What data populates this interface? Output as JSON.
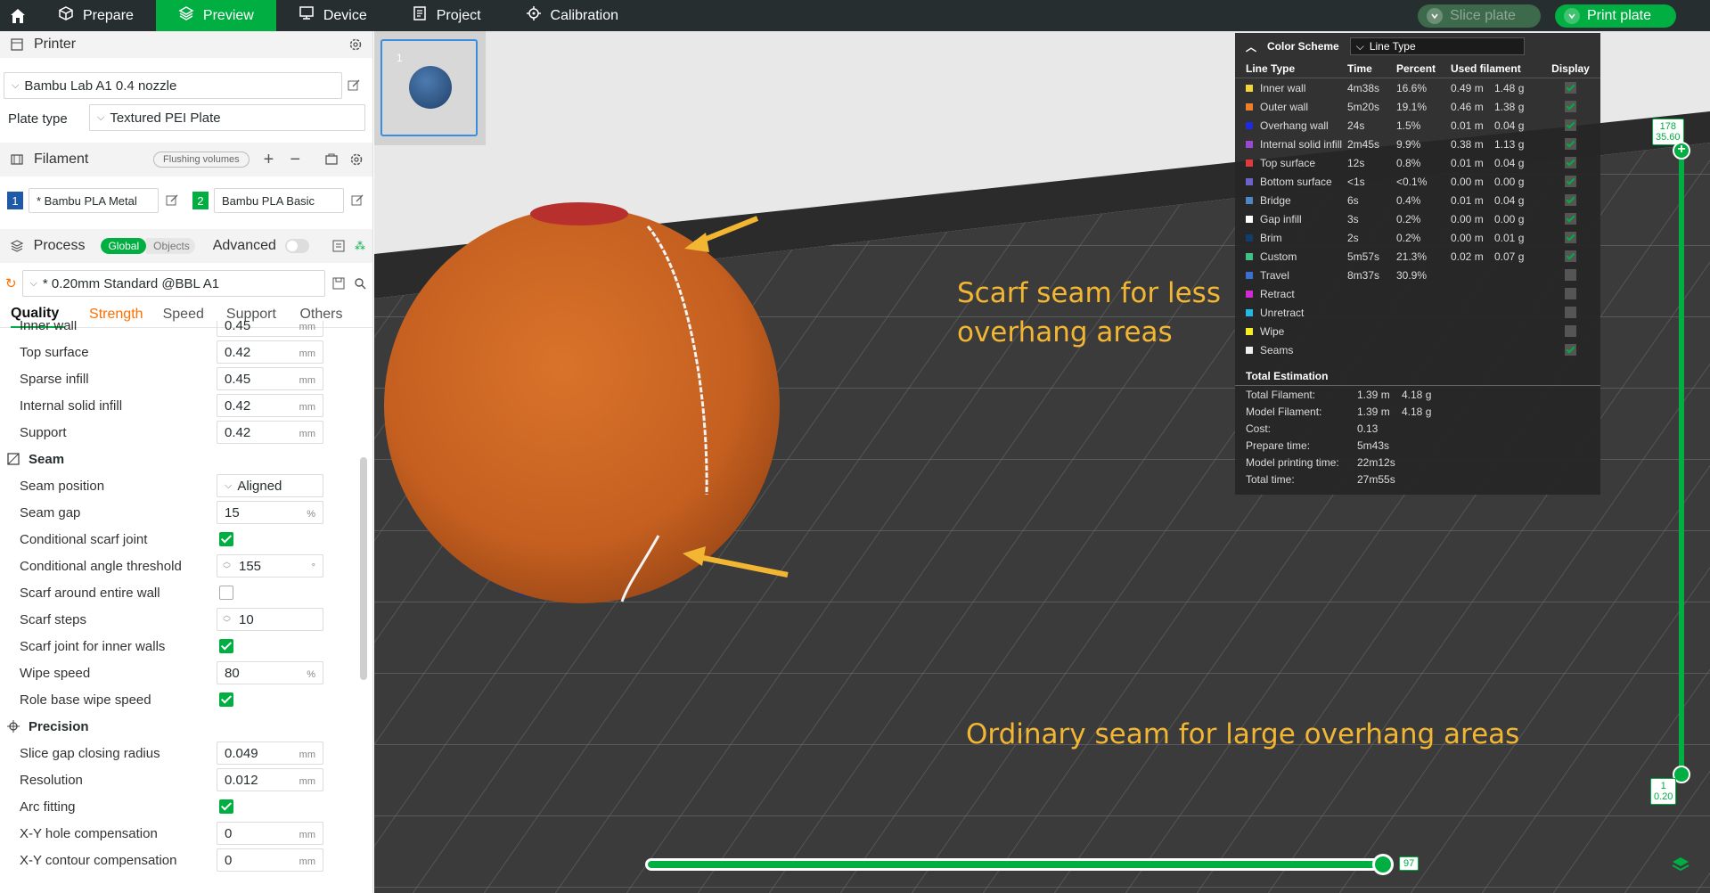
{
  "topbar": {
    "tabs": [
      {
        "label": "Prepare",
        "icon": "cube-icon"
      },
      {
        "label": "Preview",
        "icon": "layers-icon",
        "active": true
      },
      {
        "label": "Device",
        "icon": "device-icon"
      },
      {
        "label": "Project",
        "icon": "project-icon"
      },
      {
        "label": "Calibration",
        "icon": "calibration-icon"
      }
    ],
    "slice_label": "Slice plate",
    "print_label": "Print plate"
  },
  "printer": {
    "section_title": "Printer",
    "name": "Bambu Lab A1 0.4 nozzle",
    "plate_type_label": "Plate type",
    "plate_type_value": "Textured PEI Plate"
  },
  "filament": {
    "section_title": "Filament",
    "flushing_label": "Flushing volumes",
    "slots": [
      {
        "num": "1",
        "name": "* Bambu PLA Metal",
        "color": "#1f5aa6"
      },
      {
        "num": "2",
        "name": "Bambu PLA Basic",
        "color": "#00ae42"
      }
    ]
  },
  "process": {
    "section_title": "Process",
    "global_label": "Global",
    "objects_label": "Objects",
    "advanced_label": "Advanced",
    "preset": "* 0.20mm Standard @BBL A1",
    "tabs": [
      "Quality",
      "Strength",
      "Speed",
      "Support",
      "Others"
    ]
  },
  "settings": {
    "inner_wall": {
      "label": "Inner wall",
      "value": "0.45",
      "unit": "mm"
    },
    "top_surface": {
      "label": "Top surface",
      "value": "0.42",
      "unit": "mm"
    },
    "sparse_infill": {
      "label": "Sparse infill",
      "value": "0.45",
      "unit": "mm"
    },
    "internal_solid_infill": {
      "label": "Internal solid infill",
      "value": "0.42",
      "unit": "mm"
    },
    "support": {
      "label": "Support",
      "value": "0.42",
      "unit": "mm"
    },
    "seam_group": "Seam",
    "seam_position": {
      "label": "Seam position",
      "value": "Aligned"
    },
    "seam_gap": {
      "label": "Seam gap",
      "value": "15",
      "unit": "%"
    },
    "conditional_scarf": {
      "label": "Conditional scarf joint",
      "checked": true
    },
    "conditional_angle": {
      "label": "Conditional angle threshold",
      "value": "155",
      "unit": "°"
    },
    "scarf_entire_wall": {
      "label": "Scarf around entire wall",
      "checked": false
    },
    "scarf_steps": {
      "label": "Scarf steps",
      "value": "10"
    },
    "scarf_inner_walls": {
      "label": "Scarf joint for inner walls",
      "checked": true
    },
    "wipe_speed": {
      "label": "Wipe speed",
      "value": "80",
      "unit": "%"
    },
    "role_base_wipe": {
      "label": "Role base wipe speed",
      "checked": true
    },
    "precision_group": "Precision",
    "slice_gap": {
      "label": "Slice gap closing radius",
      "value": "0.049",
      "unit": "mm"
    },
    "resolution": {
      "label": "Resolution",
      "value": "0.012",
      "unit": "mm"
    },
    "arc_fitting": {
      "label": "Arc fitting",
      "checked": true
    },
    "xy_hole": {
      "label": "X-Y hole compensation",
      "value": "0",
      "unit": "mm"
    },
    "xy_contour": {
      "label": "X-Y contour compensation",
      "value": "0",
      "unit": "mm"
    }
  },
  "plate_thumb": {
    "number": "1"
  },
  "legend": {
    "title": "Color Scheme",
    "scheme": "Line Type",
    "columns": [
      "Line Type",
      "Time",
      "Percent",
      "Used filament",
      "",
      "Display"
    ],
    "rows": [
      {
        "name": "Inner wall",
        "color": "#f2d33a",
        "time": "4m38s",
        "percent": "16.6%",
        "len": "0.49 m",
        "weight": "1.48 g",
        "on": true
      },
      {
        "name": "Outer wall",
        "color": "#f07f2c",
        "time": "5m20s",
        "percent": "19.1%",
        "len": "0.46 m",
        "weight": "1.38 g",
        "on": true
      },
      {
        "name": "Overhang wall",
        "color": "#1d2ae0",
        "time": "24s",
        "percent": "1.5%",
        "len": "0.01 m",
        "weight": "0.04 g",
        "on": true
      },
      {
        "name": "Internal solid infill",
        "color": "#9b4ad0",
        "time": "2m45s",
        "percent": "9.9%",
        "len": "0.38 m",
        "weight": "1.13 g",
        "on": true
      },
      {
        "name": "Top surface",
        "color": "#e03a3a",
        "time": "12s",
        "percent": "0.8%",
        "len": "0.01 m",
        "weight": "0.04 g",
        "on": true
      },
      {
        "name": "Bottom surface",
        "color": "#6c63c9",
        "time": "<1s",
        "percent": "<0.1%",
        "len": "0.00 m",
        "weight": "0.00 g",
        "on": true
      },
      {
        "name": "Bridge",
        "color": "#4f86c4",
        "time": "6s",
        "percent": "0.4%",
        "len": "0.01 m",
        "weight": "0.04 g",
        "on": true
      },
      {
        "name": "Gap infill",
        "color": "#ffffff",
        "time": "3s",
        "percent": "0.2%",
        "len": "0.00 m",
        "weight": "0.00 g",
        "on": true
      },
      {
        "name": "Brim",
        "color": "#0f3e6e",
        "time": "2s",
        "percent": "0.2%",
        "len": "0.00 m",
        "weight": "0.01 g",
        "on": true
      },
      {
        "name": "Custom",
        "color": "#3fc287",
        "time": "5m57s",
        "percent": "21.3%",
        "len": "0.02 m",
        "weight": "0.07 g",
        "on": true
      },
      {
        "name": "Travel",
        "color": "#3a6fd6",
        "time": "8m37s",
        "percent": "30.9%",
        "len": "",
        "weight": "",
        "on": false
      },
      {
        "name": "Retract",
        "color": "#d12ad1",
        "time": "",
        "percent": "",
        "len": "",
        "weight": "",
        "on": false
      },
      {
        "name": "Unretract",
        "color": "#21b9e6",
        "time": "",
        "percent": "",
        "len": "",
        "weight": "",
        "on": false
      },
      {
        "name": "Wipe",
        "color": "#f5ee26",
        "time": "",
        "percent": "",
        "len": "",
        "weight": "",
        "on": false
      },
      {
        "name": "Seams",
        "color": "#f0f0f0",
        "time": "",
        "percent": "",
        "len": "",
        "weight": "",
        "on": true
      }
    ],
    "total_title": "Total Estimation",
    "totals": [
      {
        "k": "Total Filament:",
        "v1": "1.39 m",
        "v2": "4.18 g"
      },
      {
        "k": "Model Filament:",
        "v1": "1.39 m",
        "v2": "4.18 g"
      },
      {
        "k": "Cost:",
        "v1": "0.13",
        "v2": ""
      },
      {
        "k": "Prepare time:",
        "v1": "5m43s",
        "v2": ""
      },
      {
        "k": "Model printing time:",
        "v1": "22m12s",
        "v2": ""
      },
      {
        "k": "Total time:",
        "v1": "27m55s",
        "v2": ""
      }
    ]
  },
  "annotations": {
    "scarf": [
      "Scarf seam for less",
      "overhang areas"
    ],
    "ordinary": "Ordinary seam for large overhang areas"
  },
  "vslider": {
    "top_layer": "178",
    "top_height": "35.60",
    "bottom_layer": "1",
    "bottom_height": "0.20"
  },
  "hslider": {
    "value": "97"
  }
}
